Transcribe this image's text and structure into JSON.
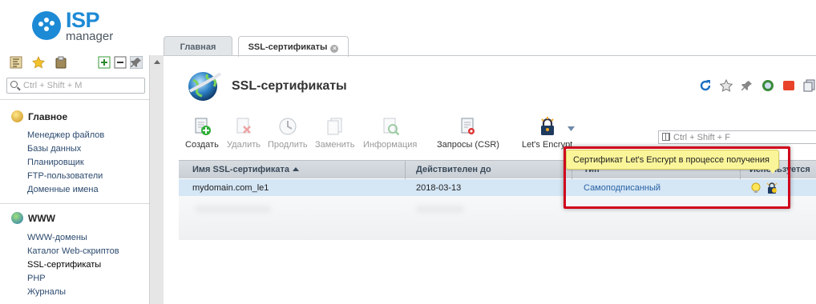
{
  "logo": {
    "brand": "ISP",
    "sub": "manager"
  },
  "search_left": {
    "placeholder": "Ctrl + Shift + M"
  },
  "nav": {
    "groups": [
      {
        "label": "Главное",
        "items": [
          "Менеджер файлов",
          "Базы данных",
          "Планировщик",
          "FTP-пользователи",
          "Доменные имена"
        ]
      },
      {
        "label": "WWW",
        "items": [
          "WWW-домены",
          "Каталог Web-скриптов",
          "SSL-сертификаты",
          "PHP",
          "Журналы"
        ]
      }
    ],
    "active_item": "SSL-сертификаты"
  },
  "tabs": [
    {
      "label": "Главная",
      "active": false
    },
    {
      "label": "SSL-сертификаты",
      "active": true,
      "close": "×"
    }
  ],
  "page": {
    "title": "SSL-сертификаты"
  },
  "toolbar": {
    "buttons": [
      {
        "label": "Создать",
        "enabled": true,
        "icon": "create-icon"
      },
      {
        "label": "Удалить",
        "enabled": false,
        "icon": "delete-icon"
      },
      {
        "label": "Продлить",
        "enabled": false,
        "icon": "renew-icon"
      },
      {
        "label": "Заменить",
        "enabled": false,
        "icon": "replace-icon"
      },
      {
        "label": "Информация",
        "enabled": false,
        "icon": "info-icon"
      },
      {
        "label": "Запросы (CSR)",
        "enabled": true,
        "icon": "csr-icon"
      },
      {
        "label": "Let's Encrypt",
        "enabled": true,
        "icon": "lets-encrypt-icon"
      }
    ]
  },
  "search_right": {
    "placeholder": "Ctrl + Shift + F"
  },
  "table": {
    "columns": [
      "Имя SSL-сертификата",
      "Действителен до",
      "Тип",
      "Используется"
    ],
    "sorted_column": "Имя SSL-сертификата",
    "rows": [
      {
        "name": "mydomain.com_le1",
        "valid_until": "2018-03-13",
        "type": "Самоподписанный",
        "selected": true
      }
    ]
  },
  "tooltip": {
    "text": "Сертификат Let's Encrypt в процессе получения"
  },
  "colors": {
    "accent": "#1d8ad6",
    "tooltip_bg": "#fbf59a",
    "highlight": "#d0021b",
    "selected_row": "#d5e6f5"
  }
}
